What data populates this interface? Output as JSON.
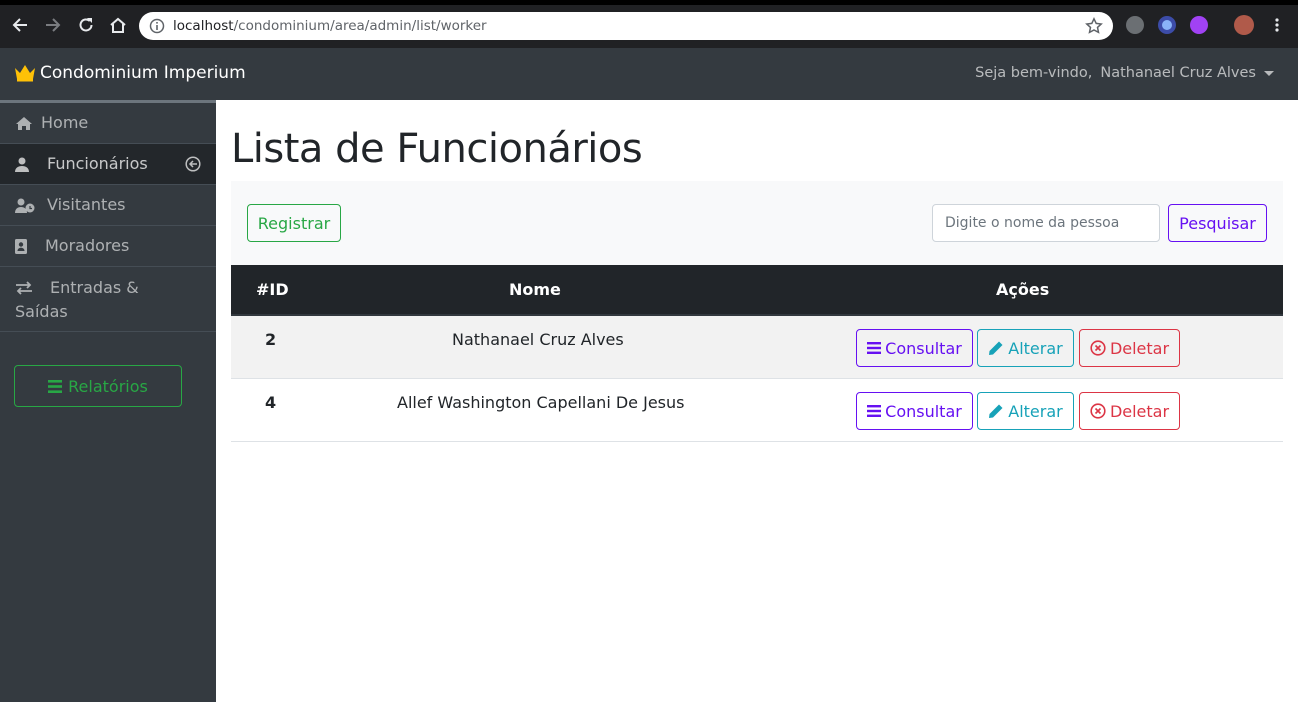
{
  "browser": {
    "url_host": "localhost",
    "url_path": "/condominium/area/admin/list/worker"
  },
  "navbar": {
    "brand": "Condominium Imperium",
    "welcome": "Seja bem-vindo,",
    "user": "Nathanael Cruz Alves"
  },
  "sidebar": {
    "items": [
      {
        "label": "Home",
        "icon": "home-icon"
      },
      {
        "label": "Funcionários",
        "icon": "user-tie-icon",
        "active": true
      },
      {
        "label": "Visitantes",
        "icon": "user-clock-icon"
      },
      {
        "label": "Moradores",
        "icon": "address-book-icon"
      },
      {
        "label": "Entradas & Saídas",
        "label_line1": "Entradas &",
        "label_line2": "Saídas",
        "icon": "exchange-icon"
      }
    ],
    "reports_label": "Relatórios"
  },
  "main": {
    "title": "Lista de Funcionários",
    "register_label": "Registrar",
    "search_placeholder": "Digite o nome da pessoa",
    "search_label": "Pesquisar"
  },
  "table": {
    "headers": [
      "#ID",
      "Nome",
      "Ações"
    ],
    "rows": [
      {
        "id": "2",
        "name": "Nathanael Cruz Alves"
      },
      {
        "id": "4",
        "name": "Allef Washington Capellani De Jesus"
      }
    ],
    "actions": {
      "view": "Consultar",
      "edit": "Alterar",
      "delete": "Deletar"
    }
  },
  "colors": {
    "navbar": "#343a40",
    "success": "#28a745",
    "indigo": "#6610f2",
    "info": "#17a2b8",
    "danger": "#dc3545",
    "crown": "#ffc107"
  }
}
